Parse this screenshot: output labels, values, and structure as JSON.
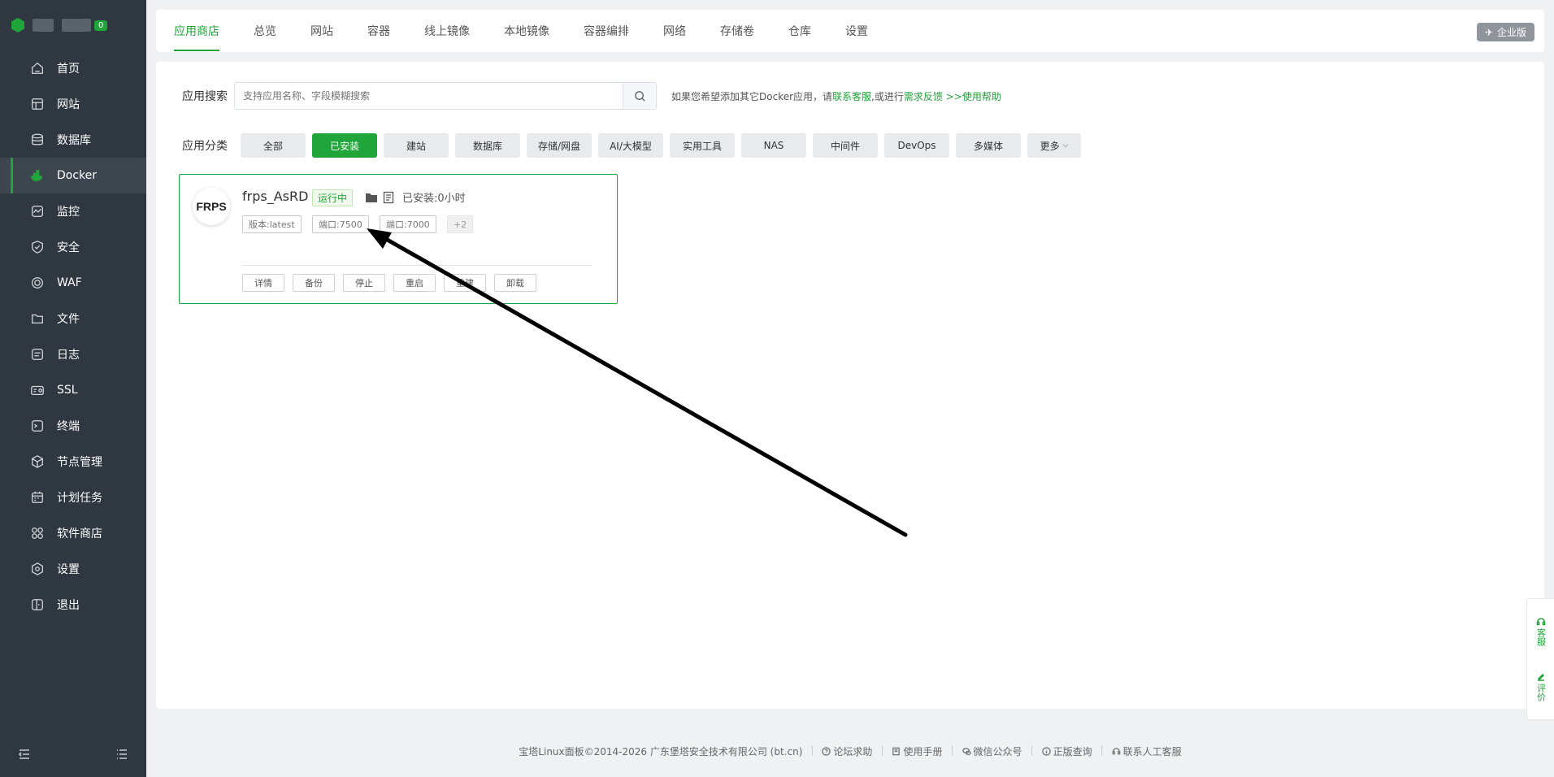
{
  "sidebar": {
    "badge": "0",
    "items": [
      {
        "label": "首页",
        "icon": "home-icon"
      },
      {
        "label": "网站",
        "icon": "globe-icon"
      },
      {
        "label": "数据库",
        "icon": "database-icon"
      },
      {
        "label": "Docker",
        "icon": "docker-icon"
      },
      {
        "label": "监控",
        "icon": "monitor-icon"
      },
      {
        "label": "安全",
        "icon": "shield-icon"
      },
      {
        "label": "WAF",
        "icon": "waf-icon"
      },
      {
        "label": "文件",
        "icon": "folder-icon"
      },
      {
        "label": "日志",
        "icon": "log-icon"
      },
      {
        "label": "SSL",
        "icon": "ssl-icon"
      },
      {
        "label": "终端",
        "icon": "terminal-icon"
      },
      {
        "label": "节点管理",
        "icon": "node-icon"
      },
      {
        "label": "计划任务",
        "icon": "calendar-icon"
      },
      {
        "label": "软件商店",
        "icon": "apps-icon"
      },
      {
        "label": "设置",
        "icon": "gear-icon"
      },
      {
        "label": "退出",
        "icon": "logout-icon"
      }
    ],
    "active_index": 3
  },
  "tabs": [
    "应用商店",
    "总览",
    "网站",
    "容器",
    "线上镜像",
    "本地镜像",
    "容器编排",
    "网络",
    "存储卷",
    "仓库",
    "设置"
  ],
  "enterprise_label": "企业版",
  "search": {
    "label": "应用搜索",
    "placeholder": "支持应用名称、字段模糊搜索",
    "hint_prefix": "如果您希望添加其它Docker应用，请",
    "hint_link1": "联系客服",
    "hint_mid": ",或进行",
    "hint_link2": "需求反馈",
    "hint_sep": " >>",
    "hint_link3": "使用帮助"
  },
  "category": {
    "label": "应用分类",
    "items": [
      "全部",
      "已安装",
      "建站",
      "数据库",
      "存储/网盘",
      "AI/大模型",
      "实用工具",
      "NAS",
      "中间件",
      "DevOps",
      "多媒体"
    ],
    "active_index": 1,
    "more": "更多"
  },
  "app": {
    "logo_text": "FRPS",
    "name": "frps_AsRD",
    "status": "运行中",
    "installed": "已安装:0小时",
    "tags": [
      "版本:latest",
      "端口:7500",
      "端口:7000",
      "+2"
    ],
    "actions": [
      "详情",
      "备份",
      "停止",
      "重启",
      "重建",
      "卸载"
    ]
  },
  "float": {
    "service": "客服",
    "review": "评价"
  },
  "footer": {
    "copyright": "宝塔Linux面板©2014-2026 广东堡塔安全技术有限公司 (bt.cn)",
    "links": [
      "论坛求助",
      "使用手册",
      "微信公众号",
      "正版查询",
      "联系人工客服"
    ]
  },
  "colors": {
    "accent": "#20a53a",
    "sidebar": "#2f3740",
    "annotation_arrow": "#000000"
  }
}
